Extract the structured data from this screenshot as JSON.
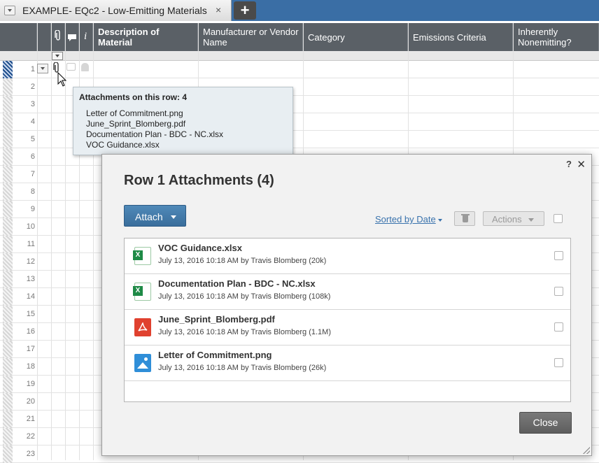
{
  "tab": {
    "title": "EXAMPLE- EQc2 - Low-Emitting Materials",
    "close_glyph": "×",
    "add_glyph": "+"
  },
  "grid": {
    "columns": [
      {
        "label": "Description of Material"
      },
      {
        "label": "Manufacturer or Vendor Name"
      },
      {
        "label": "Category"
      },
      {
        "label": "Emissions Criteria"
      },
      {
        "label": "Inherently Nonemitting?"
      }
    ],
    "info_glyph": "i",
    "row_numbers": [
      "1",
      "2",
      "3",
      "4",
      "5",
      "6",
      "7",
      "8",
      "9",
      "10",
      "11",
      "12",
      "13",
      "14",
      "15",
      "16",
      "17",
      "18",
      "19",
      "20",
      "21",
      "22",
      "23"
    ]
  },
  "tooltip": {
    "title": "Attachments on this row: 4",
    "items": [
      "Letter of Commitment.png",
      "June_Sprint_Blomberg.pdf",
      "Documentation Plan - BDC - NC.xlsx",
      "VOC Guidance.xlsx"
    ]
  },
  "dialog": {
    "title": "Row 1 Attachments (4)",
    "help_glyph": "?",
    "close_glyph": "✕",
    "attach_label": "Attach",
    "sorted_label": "Sorted by Date",
    "actions_label": "Actions",
    "close_label": "Close",
    "attachments": [
      {
        "name": "VOC Guidance.xlsx",
        "meta": "July 13, 2016 10:18 AM by Travis Blomberg (20k)",
        "icon": "excel-file-icon"
      },
      {
        "name": "Documentation Plan - BDC - NC.xlsx",
        "meta": "July 13, 2016 10:18 AM by Travis Blomberg (108k)",
        "icon": "excel-file-icon"
      },
      {
        "name": "June_Sprint_Blomberg.pdf",
        "meta": "July 13, 2016 10:18 AM by Travis Blomberg (1.1M)",
        "icon": "pdf-file-icon"
      },
      {
        "name": "Letter of Commitment.png",
        "meta": "July 13, 2016 10:18 AM by Travis Blomberg (26k)",
        "icon": "image-file-icon"
      }
    ]
  },
  "colors": {
    "tabbar": "#3a6ea5",
    "header": "#5a6066",
    "attach_button": "#3f78a8",
    "link": "#3a73ad",
    "close_button": "#666666"
  }
}
